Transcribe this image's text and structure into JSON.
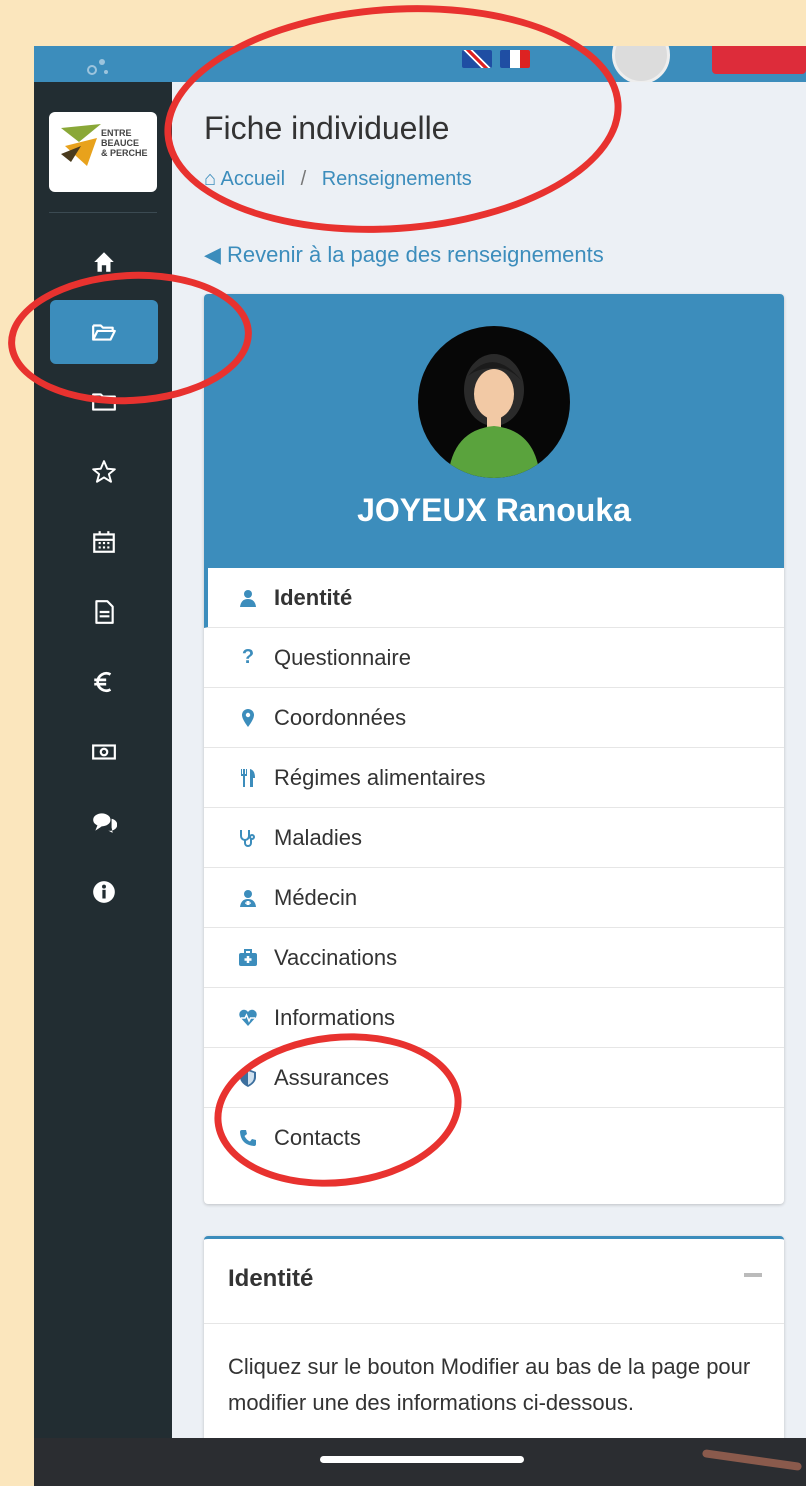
{
  "header": {
    "page_title": "Fiche individuelle",
    "breadcrumb": [
      "Accueil",
      "/",
      "Renseignements"
    ],
    "back_link": "Revenir à la page des renseignements"
  },
  "brand": {
    "lines": [
      "ENTRE",
      "BEAUCE",
      "& PERCHE"
    ]
  },
  "sidebar": {
    "items": [
      {
        "icon": "home-icon"
      },
      {
        "icon": "folder-open-icon",
        "active": true
      },
      {
        "icon": "folder-icon"
      },
      {
        "icon": "star-icon"
      },
      {
        "icon": "calendar-icon"
      },
      {
        "icon": "document-icon"
      },
      {
        "icon": "euro-icon"
      },
      {
        "icon": "money-icon"
      },
      {
        "icon": "comments-icon"
      },
      {
        "icon": "info-icon"
      }
    ]
  },
  "profile": {
    "name": "JOYEUX Ranouka",
    "menu": [
      {
        "label": "Identité",
        "icon": "user-icon",
        "active": true
      },
      {
        "label": "Questionnaire",
        "icon": "question-icon"
      },
      {
        "label": "Coordonnées",
        "icon": "map-marker-icon"
      },
      {
        "label": "Régimes alimentaires",
        "icon": "cutlery-icon"
      },
      {
        "label": "Maladies",
        "icon": "stethoscope-icon"
      },
      {
        "label": "Médecin",
        "icon": "doctor-icon"
      },
      {
        "label": "Vaccinations",
        "icon": "medkit-icon"
      },
      {
        "label": "Informations",
        "icon": "heartbeat-icon"
      },
      {
        "label": "Assurances",
        "icon": "shield-icon"
      },
      {
        "label": "Contacts",
        "icon": "phone-icon"
      }
    ]
  },
  "identity_box": {
    "title": "Identité",
    "text": "Cliquez sur le bouton Modifier au bas de la page pour modifier une des informations ci-dessous."
  },
  "colors": {
    "primary": "#3c8dbc",
    "sidebar": "#222d32",
    "annotation": "#e8322f",
    "background": "#fbe6bd"
  }
}
